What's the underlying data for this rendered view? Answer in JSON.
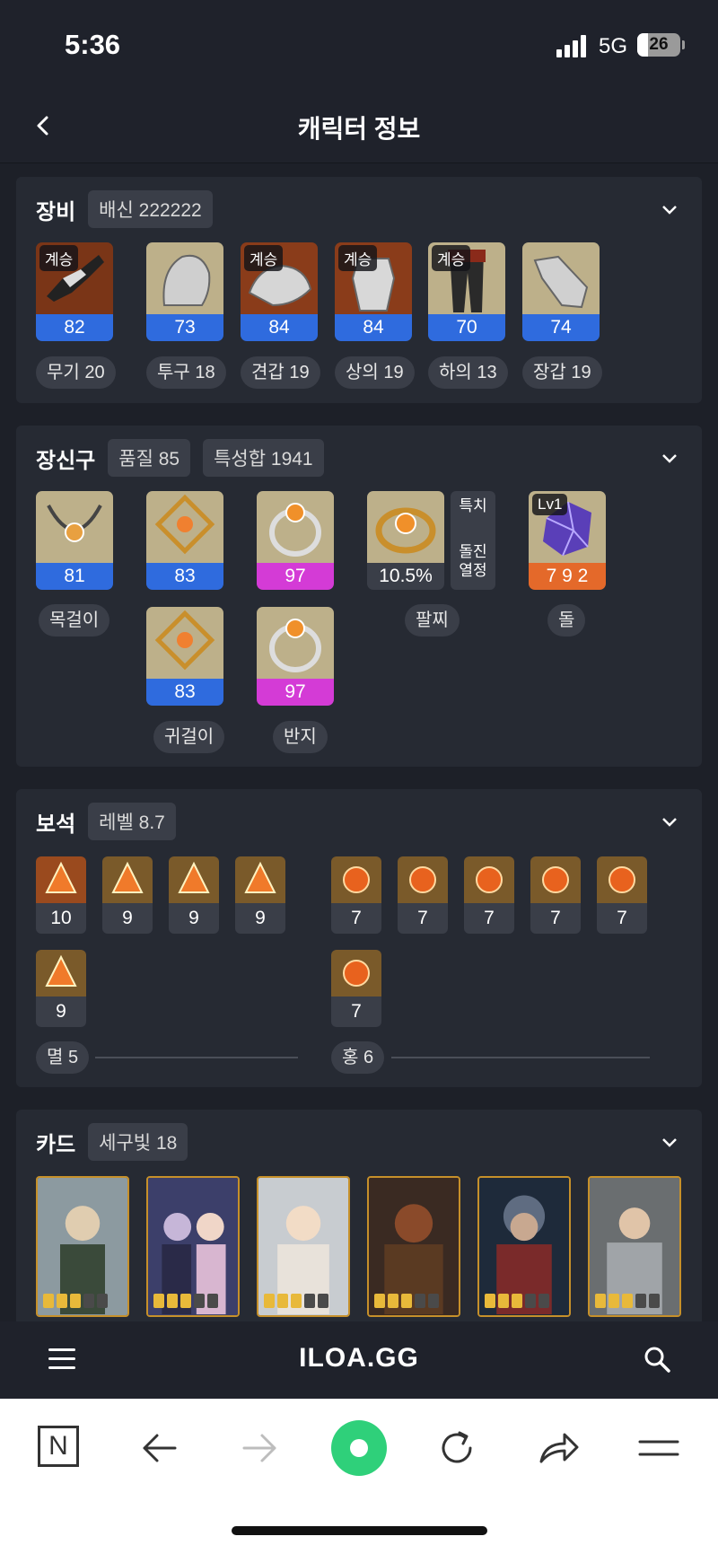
{
  "status": {
    "time": "5:36",
    "network": "5G",
    "battery": "26",
    "battery_level": 0.26
  },
  "header": {
    "title": "캐릭터 정보"
  },
  "equipment": {
    "title": "장비",
    "chip": "배신 222222",
    "items": [
      {
        "badge": "계승",
        "value": "82",
        "label": "무기 20",
        "icon": "weapon-icon"
      },
      {
        "badge": "",
        "value": "73",
        "label": "투구 18",
        "icon": "helmet-icon"
      },
      {
        "badge": "계승",
        "value": "84",
        "label": "견갑 19",
        "icon": "shoulder-icon"
      },
      {
        "badge": "계승",
        "value": "84",
        "label": "상의 19",
        "icon": "chest-armor-icon"
      },
      {
        "badge": "계승",
        "value": "70",
        "label": "하의 13",
        "icon": "pants-icon"
      },
      {
        "badge": "",
        "value": "74",
        "label": "장갑 19",
        "icon": "gloves-icon"
      }
    ]
  },
  "accessories": {
    "title": "장신구",
    "chip_quality": "품질 85",
    "chip_stats": "특성합 1941",
    "items": [
      {
        "value": "81",
        "icon": "necklace-icon"
      },
      {
        "value": "83",
        "icon": "earring-icon"
      },
      {
        "value": "97",
        "icon": "ring-icon"
      },
      {
        "value": "83",
        "icon": "earring-icon"
      },
      {
        "value": "97",
        "icon": "ring-icon"
      }
    ],
    "labels": {
      "necklace": "목걸이",
      "earring": "귀걸이",
      "ring": "반지",
      "bracelet": "팔찌",
      "stone": "돌"
    },
    "bracelet": {
      "value": "10.5%",
      "side_top": "특치",
      "side_bottom_1": "돌진",
      "side_bottom_2": "열정"
    },
    "stone": {
      "badge": "Lv1",
      "value": "7 9 2"
    }
  },
  "gems": {
    "title": "보석",
    "chip": "레벨 8.7",
    "left": [
      "10",
      "9",
      "9",
      "9",
      "9"
    ],
    "right": [
      "7",
      "7",
      "7",
      "7",
      "7",
      "7"
    ],
    "left_label": "멸 5",
    "right_label": "홍 6"
  },
  "cards": {
    "title": "카드",
    "chip": "세구빛 18",
    "awakening": [
      3,
      3,
      3,
      3,
      3,
      3
    ]
  },
  "tabbar": {
    "logo": "ILOA.GG"
  },
  "browser": {
    "n_label": "N"
  },
  "colors": {
    "bg": "#1d2028",
    "panel": "#262a33",
    "blue": "#2f6bde",
    "pink": "#d43bd6",
    "orange": "#e4692a"
  }
}
